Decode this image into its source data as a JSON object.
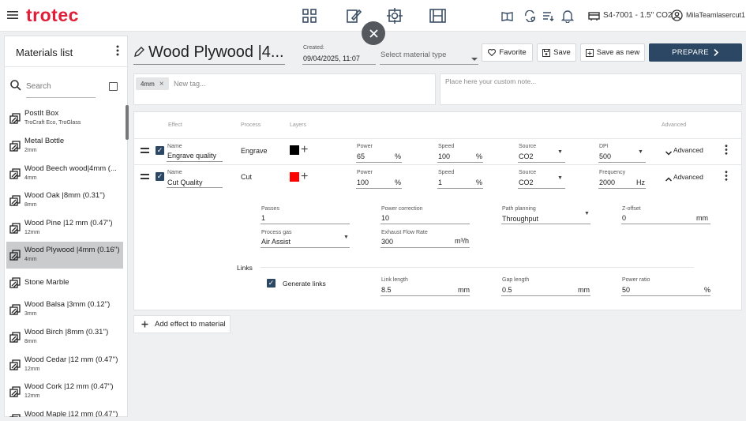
{
  "brand": "trotec",
  "topbar": {
    "device": "S4-7001 - 1.5\" CO2",
    "user": "MilaTeamlasercut1",
    "icons": [
      "menu-icon",
      "grid-icon",
      "edit-design-icon",
      "focus-icon",
      "job-film-icon",
      "book-icon",
      "settings-sync-icon",
      "list-sort-icon",
      "bell-icon",
      "laser-device-icon",
      "user-circle-icon"
    ]
  },
  "sidebar": {
    "title": "Materials list",
    "search_placeholder": "Search",
    "items": [
      {
        "name": "PostIt Box",
        "sub": "TroCraft Eco, TroGlass"
      },
      {
        "name": "Metal Bottle",
        "sub": "2mm"
      },
      {
        "name": "Wood Beech wood|4mm (...",
        "sub": "4mm"
      },
      {
        "name": "Wood Oak |8mm (0.31'')",
        "sub": "8mm"
      },
      {
        "name": "Wood Pine |12 mm (0.47'')",
        "sub": "12mm"
      },
      {
        "name": "Wood Plywood |4mm (0.16'')",
        "sub": "4mm",
        "selected": true
      },
      {
        "name": "Stone Marble",
        "sub": ""
      },
      {
        "name": "Wood Balsa |3mm (0.12'')",
        "sub": "3mm"
      },
      {
        "name": "Wood Birch |8mm (0.31'')",
        "sub": "8mm"
      },
      {
        "name": "Wood Cedar |12 mm (0.47'')",
        "sub": "12mm"
      },
      {
        "name": "Wood Cork |12 mm (0.47'')",
        "sub": "12mm"
      },
      {
        "name": "Wood Maple |12 mm (0.47'')",
        "sub": ""
      }
    ]
  },
  "header": {
    "title": "Wood Plywood |4...",
    "created_label": "Created:",
    "created_value": "09/04/2025, 11:07",
    "material_type_placeholder": "Select material type",
    "favorite_label": "Favorite",
    "save_label": "Save",
    "save_as_new_label": "Save as new",
    "prepare_label": "PREPARE"
  },
  "tags": {
    "items": [
      "4mm"
    ],
    "new_tag_placeholder": "New tag...",
    "note_placeholder": "Place here your custom note..."
  },
  "effects": {
    "headers": {
      "effect": "Effect",
      "process": "Process",
      "layers": "Layers",
      "advanced": "Advanced"
    },
    "rows": [
      {
        "name_label": "Name",
        "name": "Engrave quality",
        "process": "Engrave",
        "layer_color": "#000000",
        "power_label": "Power",
        "power": "65",
        "power_unit": "%",
        "speed_label": "Speed",
        "speed": "100",
        "speed_unit": "%",
        "source_label": "Source",
        "source": "CO2",
        "extra_label": "DPI",
        "extra": "500",
        "extra_unit": "",
        "advanced_label": "Advanced"
      },
      {
        "name_label": "Name",
        "name": "Cut Quality",
        "process": "Cut",
        "layer_color": "#ff0000",
        "power_label": "Power",
        "power": "100",
        "power_unit": "%",
        "speed_label": "Speed",
        "speed": "1",
        "speed_unit": "%",
        "source_label": "Source",
        "source": "CO2",
        "extra_label": "Frequency",
        "extra": "2000",
        "extra_unit": "Hz",
        "advanced_label": "Advanced"
      }
    ],
    "advanced": {
      "passes_label": "Passes",
      "passes": "1",
      "power_correction_label": "Power correction",
      "power_correction": "10",
      "path_planning_label": "Path planning",
      "path_planning": "Throughput",
      "z_offset_label": "Z-offset",
      "z_offset": "0",
      "z_offset_unit": "mm",
      "process_gas_label": "Process gas",
      "process_gas": "Air Assist",
      "exhaust_label": "Exhaust Flow Rate",
      "exhaust": "300",
      "exhaust_unit": "m³/h",
      "links_label": "Links",
      "generate_links_label": "Generate links",
      "link_length_label": "Link length",
      "link_length": "8.5",
      "link_length_unit": "mm",
      "gap_length_label": "Gap length",
      "gap_length": "0.5",
      "gap_length_unit": "mm",
      "power_ratio_label": "Power ratio",
      "power_ratio": "50",
      "power_ratio_unit": "%"
    },
    "add_effect_label": "Add effect to material"
  },
  "colors": {
    "brand": "#e01e37",
    "primary": "#2b4763",
    "selected_row": "#c9cbcd"
  }
}
